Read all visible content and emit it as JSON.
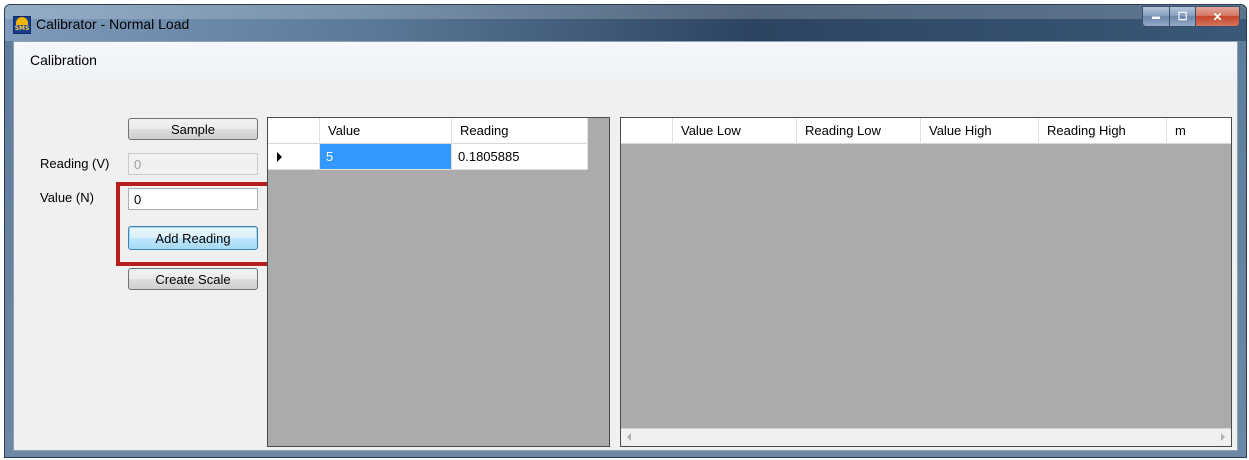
{
  "window": {
    "title": "Calibrator - Normal Load",
    "app_icon_text": "SMS",
    "min_glyph": "▬",
    "max_glyph": "☐",
    "close_glyph": "✕"
  },
  "menu": {
    "items": [
      "Calibration"
    ]
  },
  "controls": {
    "sample_label": "Sample",
    "reading_label": "Reading (V)",
    "reading_value": "0",
    "value_label": "Value (N)",
    "value_input": "0",
    "add_reading_label": "Add Reading",
    "create_scale_label": "Create Scale"
  },
  "readings_grid": {
    "columns": [
      "Value",
      "Reading"
    ],
    "rows": [
      {
        "value": "5",
        "reading": "0.1805885"
      }
    ]
  },
  "scale_grid": {
    "columns": [
      "Value Low",
      "Reading Low",
      "Value High",
      "Reading High",
      "m"
    ]
  },
  "colors": {
    "highlight": "#b41e1e",
    "selection": "#3399ff",
    "grid_bg": "#ababab"
  }
}
